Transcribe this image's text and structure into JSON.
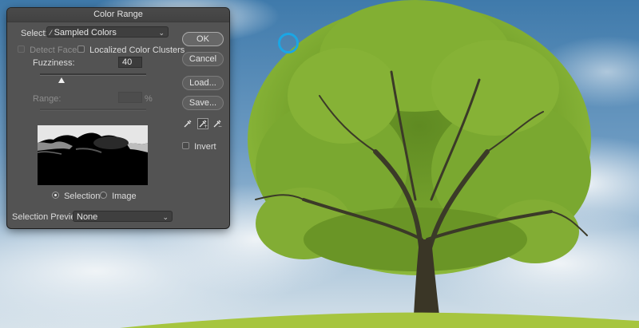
{
  "dialog": {
    "title": "Color Range",
    "select_label": "Select:",
    "select_value": "Sampled Colors",
    "detect_faces_label": "Detect Faces",
    "localized_clusters_label": "Localized Color Clusters",
    "fuzziness_label": "Fuzziness:",
    "fuzziness_value": "40",
    "fuzziness_level": 0.2,
    "range_label": "Range:",
    "range_value": "",
    "range_unit": "%",
    "buttons": {
      "ok": "OK",
      "cancel": "Cancel",
      "load": "Load...",
      "save": "Save..."
    },
    "invert_label": "Invert",
    "view_options": {
      "selection": "Selection",
      "image": "Image",
      "selected": "selection"
    },
    "selection_preview_label": "Selection Preview:",
    "selection_preview_value": "None"
  },
  "colors": {
    "sky_top": "#4f86b3",
    "sky_bottom": "#c9d9e6",
    "foliage": "#6f9d2c",
    "grass": "#9fc03a",
    "cursor_ring": "#1ba6e4"
  },
  "icons": {
    "eyedropper": "eyedropper-icon",
    "eyedropper_plus": "eyedropper-plus-icon",
    "eyedropper_minus": "eyedropper-minus-icon"
  }
}
